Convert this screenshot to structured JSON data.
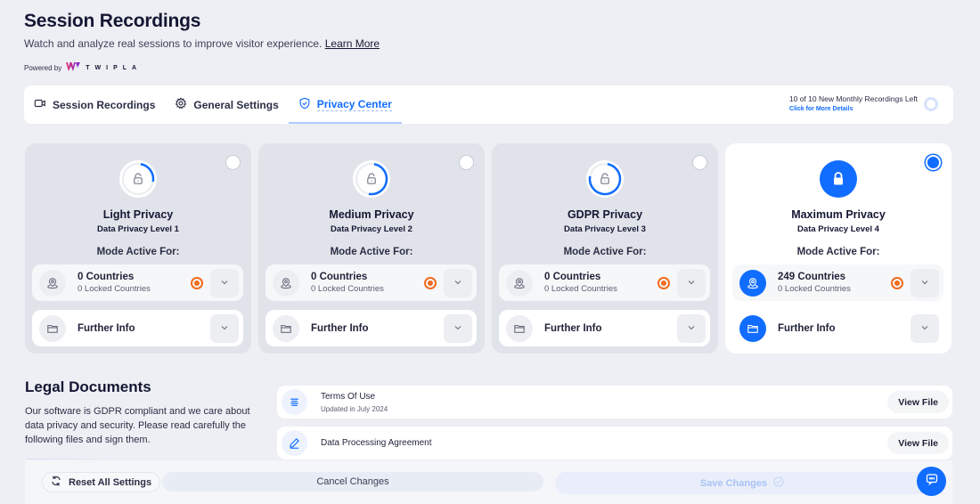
{
  "header": {
    "title": "Session Recordings",
    "subtitle": "Watch and analyze real sessions to improve visitor experience.",
    "learn_more": "Learn More",
    "powered_by": "Powered by",
    "brand_mark": "W",
    "brand_name": "TWIPLA"
  },
  "tabs": [
    {
      "label": "Session Recordings",
      "icon": "video-camera-icon",
      "active": false
    },
    {
      "label": "General Settings",
      "icon": "gear-icon",
      "active": false
    },
    {
      "label": "Privacy Center",
      "icon": "shield-check-icon",
      "active": true
    }
  ],
  "recordings_left": {
    "text": "10 of 10 New Monthly Recordings Left",
    "link": "Click for More Details"
  },
  "cards": [
    {
      "title": "Light Privacy",
      "level": "Data Privacy Level 1",
      "mode_label": "Mode Active For:",
      "countries": "0 Countries",
      "locked": "0 Locked Countries",
      "further": "Further Info",
      "selected": false,
      "progress": 0.25
    },
    {
      "title": "Medium Privacy",
      "level": "Data Privacy Level 2",
      "mode_label": "Mode Active For:",
      "countries": "0 Countries",
      "locked": "0 Locked Countries",
      "further": "Further Info",
      "selected": false,
      "progress": 0.5
    },
    {
      "title": "GDPR Privacy",
      "level": "Data Privacy Level 3",
      "mode_label": "Mode Active For:",
      "countries": "0 Countries",
      "locked": "0 Locked Countries",
      "further": "Further Info",
      "selected": false,
      "progress": 0.75
    },
    {
      "title": "Maximum Privacy",
      "level": "Data Privacy Level 4",
      "mode_label": "Mode Active For:",
      "countries": "249 Countries",
      "locked": "0 Locked Countries",
      "further": "Further Info",
      "selected": true,
      "progress": 1.0
    }
  ],
  "legal": {
    "title": "Legal Documents",
    "description": "Our software is GDPR compliant and we care about data privacy and security. Please read carefully the following files and sign them.",
    "documents": [
      {
        "title": "Terms Of Use",
        "subtitle": "Updated in July 2024",
        "action": "View File",
        "icon": "text-lines-icon"
      },
      {
        "title": "Data Processing Agreement",
        "subtitle": "",
        "action": "View File",
        "icon": "pen-icon"
      }
    ]
  },
  "footer": {
    "reset": "Reset All Settings",
    "cancel": "Cancel Changes",
    "save": "Save Changes"
  },
  "colors": {
    "accent": "#116dff",
    "orange": "#f26b1d",
    "background": "#eeeff4"
  }
}
